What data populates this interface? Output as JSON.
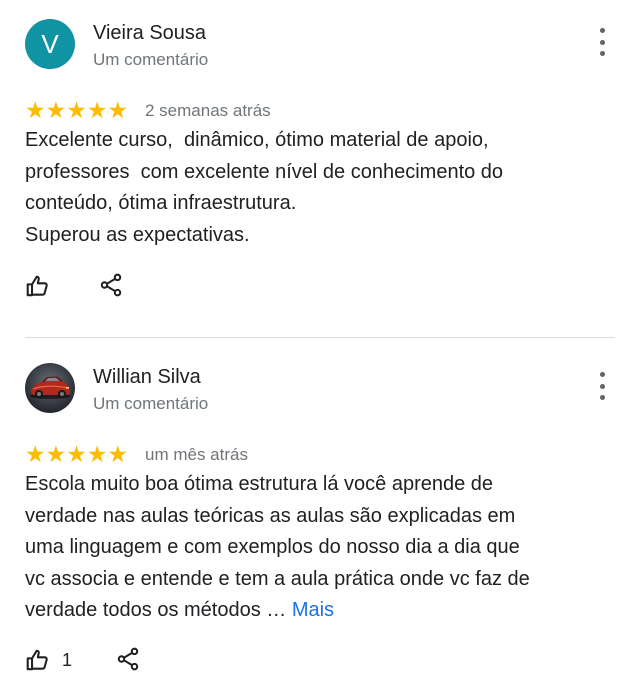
{
  "reviews": [
    {
      "avatar_letter": "V",
      "avatar_color": "#1093a3",
      "author": "Vieira Sousa",
      "meta": "Um comentário",
      "stars": "★★★★★",
      "rating": 5,
      "date": "2 semanas atrás",
      "text": "Excelente curso,  dinâmico, ótimo material de apoio,\nprofessores  com excelente nível de conhecimento do\nconteúdo, ótima infraestrutura.\nSuperou as expectativas.",
      "likes": ""
    },
    {
      "avatar_image": "car-photo",
      "author": "Willian Silva",
      "meta": "Um comentário",
      "stars": "★★★★★",
      "rating": 5,
      "date": "um mês atrás",
      "text": "Escola muito boa ótima estrutura lá você aprende de\nverdade nas aulas teóricas as aulas são explicadas em\numa linguagem e com exemplos do nosso dia a dia que\nvc associa e entende e tem a aula prática onde vc faz de\nverdade todos os métodos … ",
      "more_label": "Mais",
      "likes": "1"
    }
  ],
  "colors": {
    "star": "#fbbc04",
    "link": "#1a73e8",
    "secondary_text": "#70757a"
  },
  "icons": {
    "like": "thumbs-up-icon",
    "share": "share-icon",
    "more": "more-vert-icon"
  }
}
